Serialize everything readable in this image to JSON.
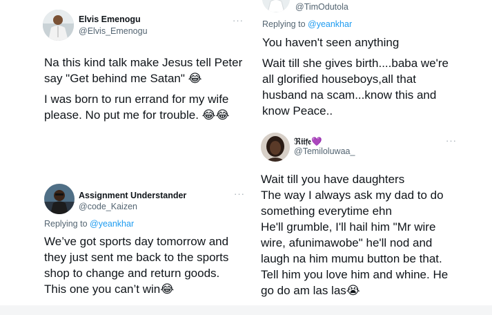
{
  "tweets": {
    "elvis": {
      "name": "Elvis Emenogu",
      "handle": "@Elvis_Emenogu",
      "more": "···",
      "paragraphs": [
        "Na this kind talk make Jesus tell Peter say \"Get behind me Satan\" 😂",
        "I was born to run errand for my wife please. No put me for trouble. 😂😂"
      ]
    },
    "tim": {
      "handle": "@TimOdutola",
      "replying_prefix": "Replying to ",
      "replying_to": "@yeankhar",
      "paragraphs": [
        "You haven't seen anything",
        "Wait till she gives birth....baba we're all glorified houseboys,all that husband na scam...know this and know Peace.."
      ]
    },
    "riife": {
      "name": "ℜ𝔦𝔦𝔣𝔢💜",
      "handle": "@Temiloluwaa_",
      "more": "···",
      "lines": [
        "Wait till you have daughters",
        "The way I always ask my dad to do",
        "something everytime ehn",
        "He'll grumble, I'll hail him \"Mr wire",
        "wire, afunimawobe\" he'll nod and",
        "laugh na him mumu button be that.",
        "Tell him you love him and whine. He",
        "go do am las las😭"
      ]
    },
    "assignment": {
      "name": "Assignment Understander",
      "handle": "@code_Kaizen",
      "more": "···",
      "replying_prefix": "Replying to ",
      "replying_to": "@yeankhar",
      "paragraphs": [
        "We’ve got sports day tomorrow and they just sent me back to the sports shop to change and return goods. This one you can’t win😂"
      ]
    }
  },
  "colors": {
    "text": "#0f1419",
    "secondary": "#536471",
    "link": "#1d9bf0",
    "divider": "#e6ecf0"
  }
}
